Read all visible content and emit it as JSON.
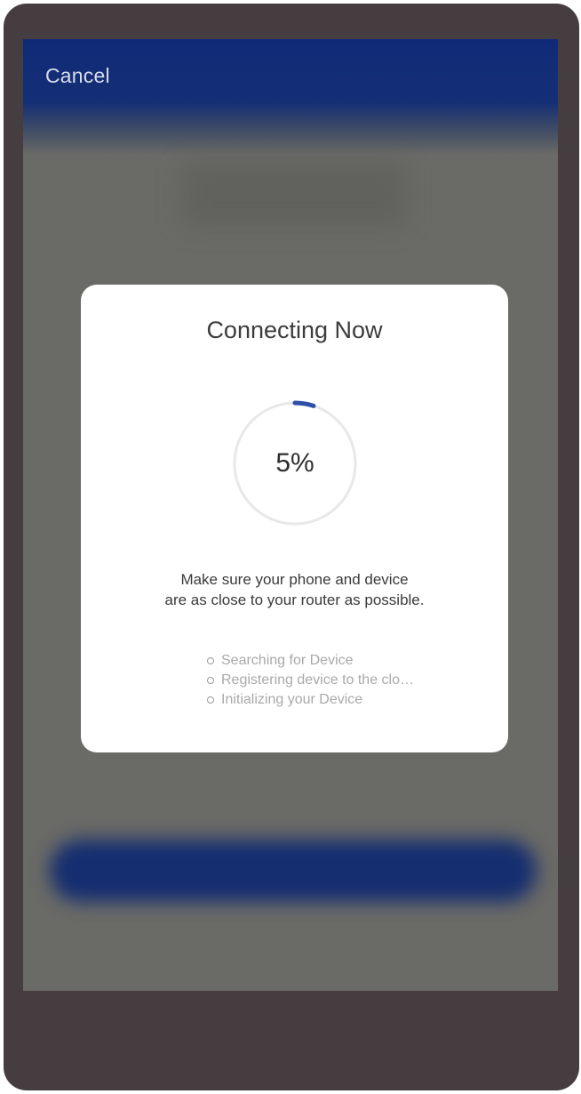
{
  "header": {
    "cancel_label": "Cancel"
  },
  "dialog": {
    "title": "Connecting Now",
    "progress_percent": 5,
    "progress_label": "5%",
    "hint_line1": "Make sure your phone and device",
    "hint_line2": "are as close to your router as possible.",
    "steps": [
      {
        "label": "Searching for Device",
        "icon": "empty-circle-icon"
      },
      {
        "label": "Registering device to the clo…",
        "icon": "empty-circle-icon"
      },
      {
        "label": "Initializing your Device",
        "icon": "empty-circle-icon"
      }
    ]
  },
  "colors": {
    "header_blue": "#112a78",
    "progress_accent": "#2d4fa8",
    "track": "#e8e8e8",
    "dialog_bg": "#ffffff",
    "frame": "#453d3f"
  }
}
